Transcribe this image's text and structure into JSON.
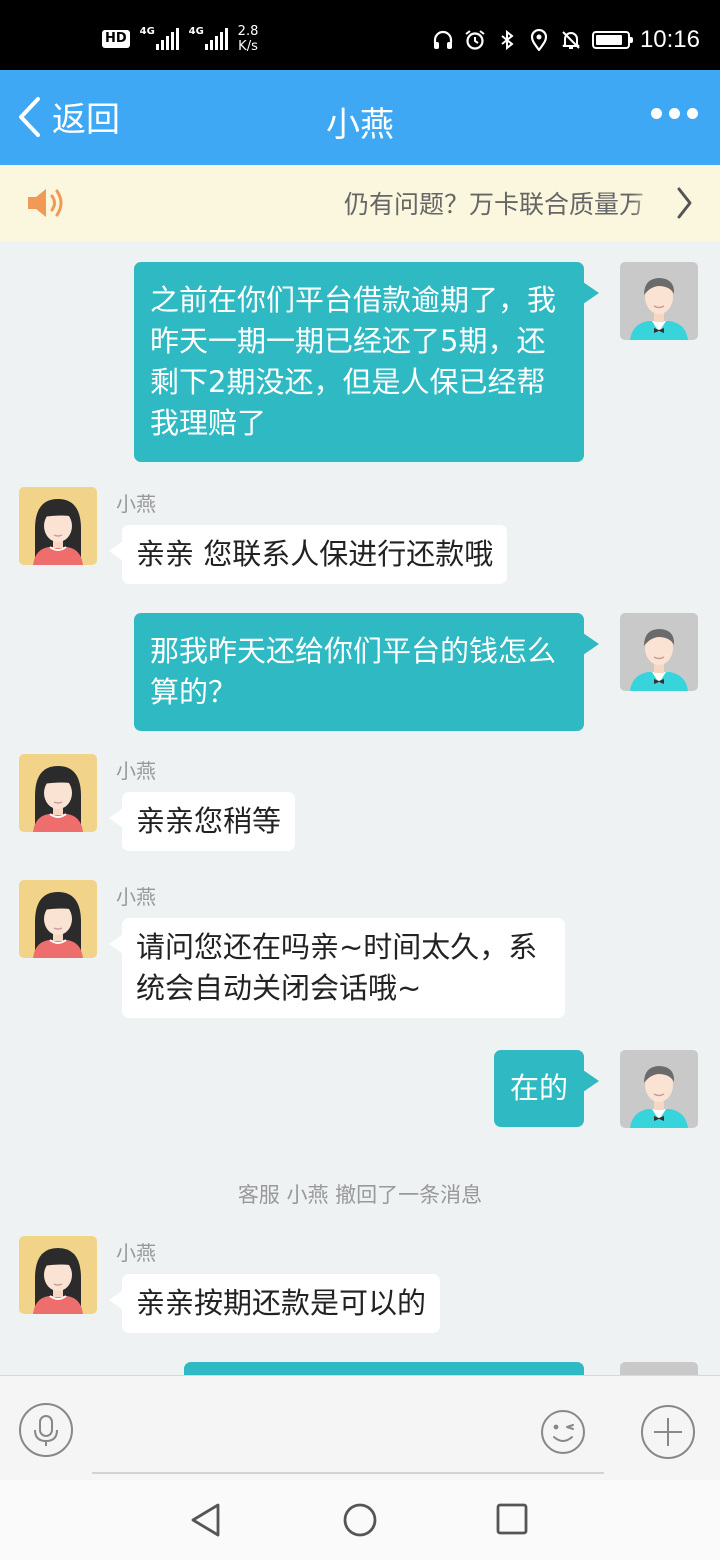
{
  "status_bar": {
    "hd_badge": "HD",
    "sim1_label": "4G",
    "sim2_label": "4G",
    "speed_value": "2.8",
    "speed_unit": "K/s",
    "time": "10:16",
    "icons": [
      "headset-icon",
      "alarm-icon",
      "bluetooth-icon",
      "location-icon",
      "notifications-off-icon",
      "battery-icon"
    ]
  },
  "header": {
    "back_label": "返回",
    "title": "小燕",
    "more_icon": "more-dots-icon"
  },
  "notice": {
    "text": "仍有问题？万卡联合质量万",
    "icon": "speaker-icon"
  },
  "messages": [
    {
      "from": "me",
      "text": "之前在你们平台借款逾期了，我昨天一期一期已经还了5期，还剩下2期没还，但是人保已经帮我理赔了"
    },
    {
      "from": "agent",
      "sender": "小燕",
      "text": "亲亲 您联系人保进行还款哦"
    },
    {
      "from": "me",
      "text": "那我昨天还给你们平台的钱怎么算的？"
    },
    {
      "from": "agent",
      "sender": "小燕",
      "text": "亲亲您稍等"
    },
    {
      "from": "agent",
      "sender": "小燕",
      "text": "请问您还在吗亲~时间太久，系统会自动关闭会话哦~"
    },
    {
      "from": "me",
      "text": "在的"
    },
    {
      "from": "system",
      "text": "客服 小燕 撤回了一条消息"
    },
    {
      "from": "agent",
      "sender": "小燕",
      "text": "亲亲按期还款是可以的"
    }
  ],
  "input_bar": {
    "icons": [
      "microphone-icon",
      "emoji-icon",
      "plus-icon"
    ]
  },
  "nav_bar": {
    "icons": [
      "nav-back-icon",
      "nav-home-icon",
      "nav-recents-icon"
    ]
  },
  "colors": {
    "header": "#3fa8f5",
    "my_bubble": "#2fb9c3",
    "agent_bubble": "#ffffff",
    "chat_background": "#eef2f3",
    "notice_background": "#fbf6de"
  }
}
